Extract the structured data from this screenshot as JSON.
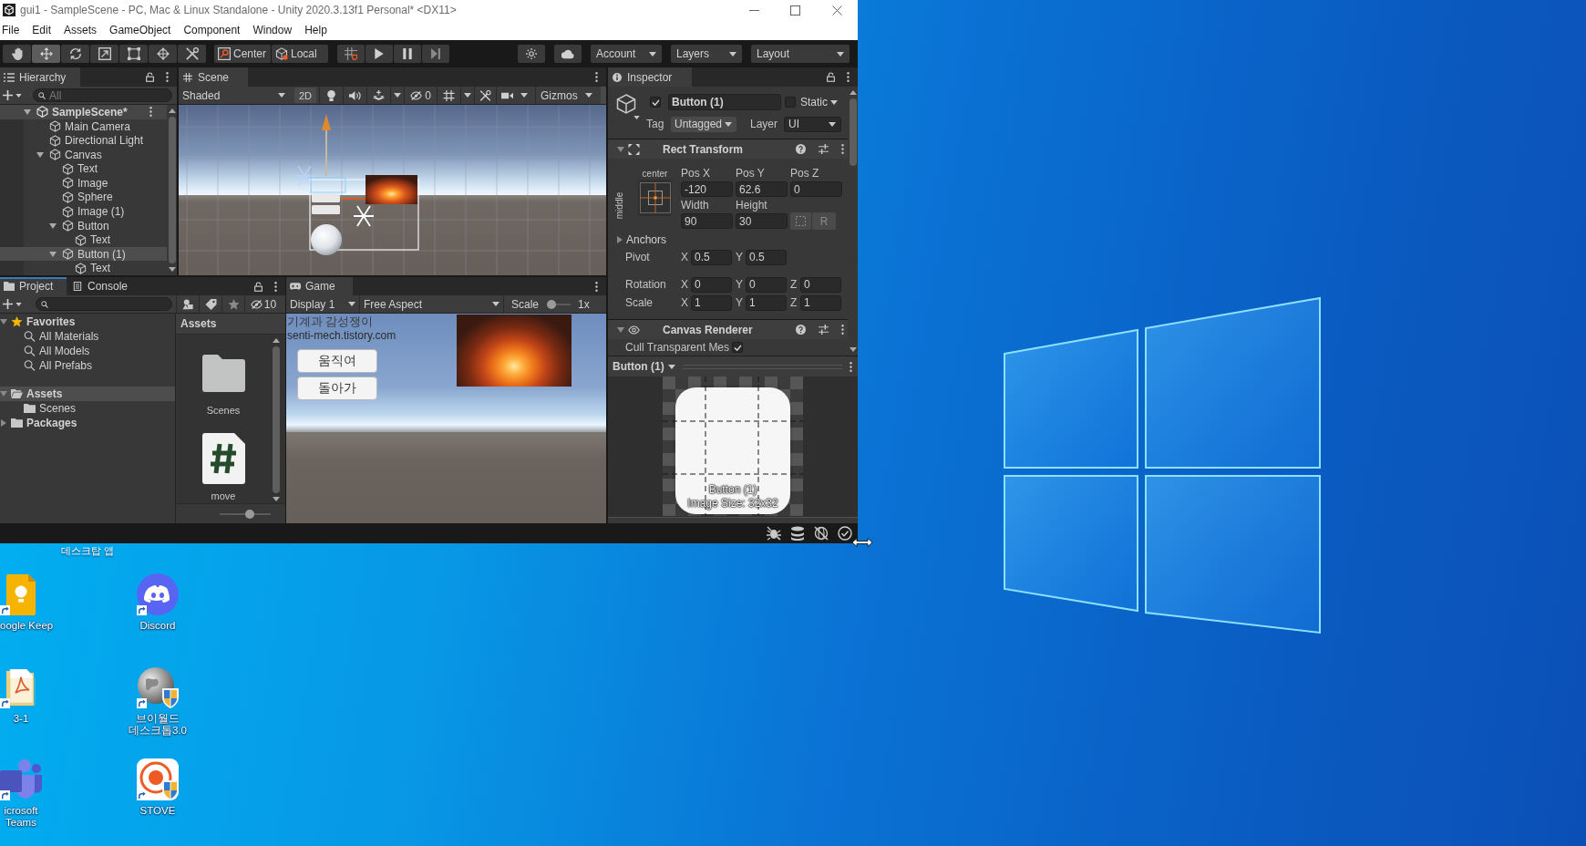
{
  "window": {
    "title": "gui1 - SampleScene - PC, Mac & Linux Standalone - Unity 2020.3.13f1 Personal* <DX11>"
  },
  "menu": [
    "File",
    "Edit",
    "Assets",
    "GameObject",
    "Component",
    "Window",
    "Help"
  ],
  "toolbar": {
    "tools": [
      {
        "kind": "hand",
        "selected": false
      },
      {
        "kind": "move",
        "selected": true
      },
      {
        "kind": "rotate",
        "selected": false
      },
      {
        "kind": "scale",
        "selected": false
      },
      {
        "kind": "rect",
        "selected": false
      },
      {
        "kind": "transform",
        "selected": false
      },
      {
        "kind": "custom",
        "selected": false
      }
    ],
    "handles": [
      {
        "kind": "pivot",
        "label": "Center"
      },
      {
        "kind": "space",
        "label": "Local"
      }
    ],
    "account": "Account",
    "layers": "Layers",
    "layout": "Layout"
  },
  "hierarchy": {
    "tab": "Hierarchy",
    "search": {
      "placeholder": "All"
    },
    "scene": {
      "label": "SampleScene*",
      "expanded": true
    },
    "items": [
      {
        "label": "Main Camera",
        "selected": false
      },
      {
        "label": "Directional Light",
        "selected": false
      },
      {
        "label": "Canvas",
        "selected": false,
        "expanded": true,
        "children": [
          {
            "label": "Text",
            "selected": false
          },
          {
            "label": "Image",
            "selected": false
          },
          {
            "label": "Sphere",
            "selected": false
          },
          {
            "label": "Image (1)",
            "selected": false
          },
          {
            "label": "Button",
            "selected": false,
            "expanded": true,
            "children": [
              {
                "label": "Text",
                "selected": false
              }
            ]
          },
          {
            "label": "Button (1)",
            "selected": true,
            "expanded": true,
            "children": [
              {
                "label": "Text",
                "selected": false
              }
            ]
          }
        ]
      }
    ]
  },
  "scene": {
    "tab": "Scene",
    "shading": "Shaded",
    "toggle_2d": {
      "label": "2D",
      "on": false
    },
    "hidden_count": "0",
    "gizmos": "Gizmos"
  },
  "inspector": {
    "tab": "Inspector",
    "object": {
      "active": true,
      "name": "Button (1)",
      "static": false,
      "static_label": "Static",
      "tag_label": "Tag",
      "tag": "Untagged",
      "layer_label": "Layer",
      "layer": "UI"
    },
    "rect_transform": {
      "title": "Rect Transform",
      "expanded": true,
      "anchor_h": "center",
      "anchor_v": "middle",
      "position": [
        {
          "label": "Pos X",
          "value": "-120"
        },
        {
          "label": "Pos Y",
          "value": "62.6"
        },
        {
          "label": "Pos Z",
          "value": "0"
        }
      ],
      "size": [
        {
          "label": "Width",
          "value": "90"
        },
        {
          "label": "Height",
          "value": "30"
        }
      ],
      "raw_button": "R",
      "anchors": {
        "label": "Anchors",
        "expanded": false
      },
      "rows": [
        {
          "label": "Pivot",
          "fields": [
            {
              "axis": "X",
              "value": "0.5"
            },
            {
              "axis": "Y",
              "value": "0.5"
            }
          ]
        },
        {
          "label": "Rotation",
          "fields": [
            {
              "axis": "X",
              "value": "0"
            },
            {
              "axis": "Y",
              "value": "0"
            },
            {
              "axis": "Z",
              "value": "0"
            }
          ]
        },
        {
          "label": "Scale",
          "fields": [
            {
              "axis": "X",
              "value": "1"
            },
            {
              "axis": "Y",
              "value": "1"
            },
            {
              "axis": "Z",
              "value": "1"
            }
          ]
        }
      ]
    },
    "canvas_renderer": {
      "title": "Canvas Renderer",
      "expanded": true,
      "cull_label": "Cull Transparent Mes",
      "cull": true
    },
    "preview": {
      "title": "Button (1)",
      "caption": "Button (1)",
      "size_text": "Image Size: 32x32"
    }
  },
  "project": {
    "tabs": [
      {
        "label": "Project",
        "selected": true,
        "focused": true
      },
      {
        "label": "Console",
        "selected": false,
        "focused": false
      }
    ],
    "hidden_count": "10",
    "tree": [
      {
        "kind": "favorites",
        "label": "Favorites",
        "expanded": true,
        "selected": false,
        "children": [
          {
            "kind": "search",
            "label": "All Materials",
            "selected": false
          },
          {
            "kind": "search",
            "label": "All Models",
            "selected": false
          },
          {
            "kind": "search",
            "label": "All Prefabs",
            "selected": false
          }
        ]
      },
      {
        "kind": "folder",
        "label": "Assets",
        "expanded": true,
        "selected": true,
        "children": [
          {
            "kind": "folder",
            "label": "Scenes",
            "selected": false
          }
        ]
      },
      {
        "kind": "folder",
        "label": "Packages",
        "expanded": false,
        "selected": false
      }
    ],
    "path": "Assets",
    "assets": [
      {
        "kind": "folder",
        "label": "Scenes"
      },
      {
        "kind": "script",
        "label": "move"
      }
    ],
    "icon_size": {
      "level": 0.6
    }
  },
  "game": {
    "tab": "Game",
    "display": "Display 1",
    "aspect": "Free Aspect",
    "scale_label": "Scale",
    "scale": {
      "level": 0
    },
    "scale_value": "1x",
    "texts": [
      "기계과 감성쟁이",
      "senti-mech.tistory.com"
    ],
    "buttons": [
      "움직여",
      "돌아가"
    ]
  },
  "desktop": {
    "caption": "데스크탑 앱",
    "icons": [
      {
        "kind": "keep",
        "lines": [
          "oogle Keep"
        ]
      },
      {
        "kind": "discord",
        "lines": [
          "Discord"
        ]
      },
      {
        "kind": "pdf",
        "lines": [
          "3-1"
        ]
      },
      {
        "kind": "globe",
        "lines": [
          "브이월드",
          "데스크톱3.0"
        ]
      },
      {
        "kind": "teams",
        "lines": [
          "icrosoft",
          "Teams"
        ]
      },
      {
        "kind": "stove",
        "lines": [
          "STOVE"
        ]
      }
    ]
  }
}
